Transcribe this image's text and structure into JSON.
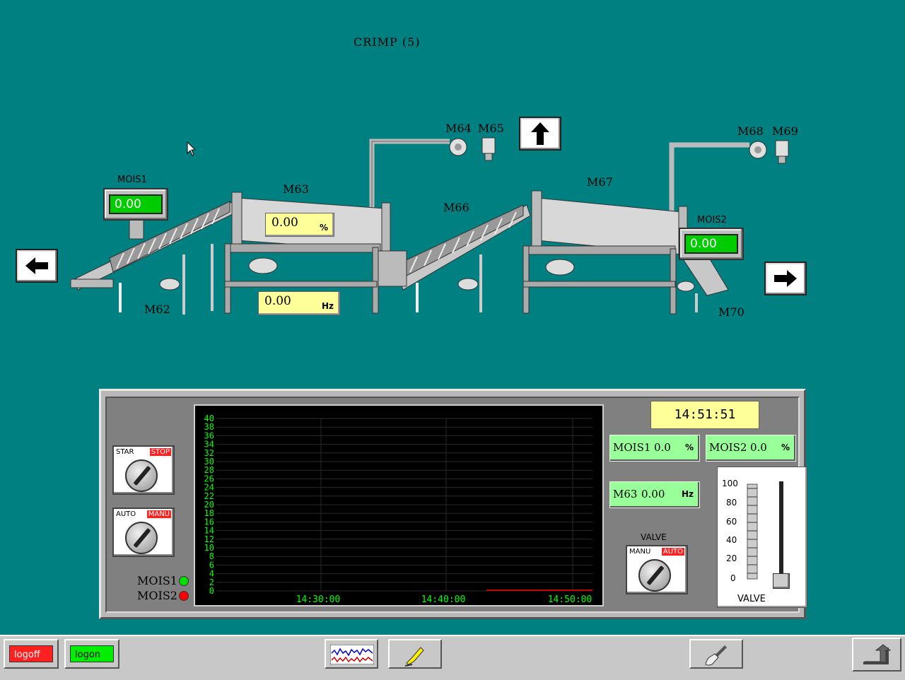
{
  "title": "CRIMP (5)",
  "machines": {
    "m62": "M62",
    "m63": "M63",
    "m64": "M64",
    "m65": "M65",
    "m66": "M66",
    "m67": "M67",
    "m68": "M68",
    "m69": "M69",
    "m70": "M70"
  },
  "mois1_meter": {
    "label": "MOIS1",
    "value": "0.00"
  },
  "mois2_meter": {
    "label": "MOIS2",
    "value": "0.00"
  },
  "m63_readout": {
    "value": "0.00",
    "unit": "%"
  },
  "hz_readout": {
    "value": "0.00",
    "unit": "Hz"
  },
  "trend": {
    "y_ticks": [
      "40",
      "38",
      "36",
      "34",
      "32",
      "30",
      "28",
      "26",
      "24",
      "22",
      "20",
      "18",
      "16",
      "14",
      "12",
      "10",
      "8",
      "6",
      "4",
      "2",
      "0"
    ],
    "x_ticks": [
      "14:30:00",
      "14:40:00",
      "14:50:00"
    ]
  },
  "clock": "14:51:51",
  "readouts": {
    "mois1": {
      "key": "MOIS1",
      "value": "0.0",
      "unit": "%"
    },
    "mois2": {
      "key": "MOIS2",
      "value": "0.0",
      "unit": "%"
    },
    "m63": {
      "key": "M63",
      "value": "0.00",
      "unit": "Hz"
    }
  },
  "switches": {
    "start_stop": {
      "left": "STAR",
      "right": "STOP"
    },
    "auto_manu": {
      "left": "AUTO",
      "right": "MANU"
    },
    "valve": {
      "title": "VALVE",
      "left": "MANU",
      "right": "AUTO"
    }
  },
  "legend": {
    "mois1": "MOIS1",
    "mois2": "MOIS2"
  },
  "slider": {
    "ticks": [
      "100",
      "80",
      "60",
      "40",
      "20",
      "0"
    ],
    "caption": "VALVE",
    "level": 0
  },
  "taskbar": {
    "logoff": "logoff",
    "logon": "logon"
  },
  "colors": {
    "background": "#008080",
    "indicator_green": "#00e000",
    "indicator_red": "#ff0000"
  }
}
